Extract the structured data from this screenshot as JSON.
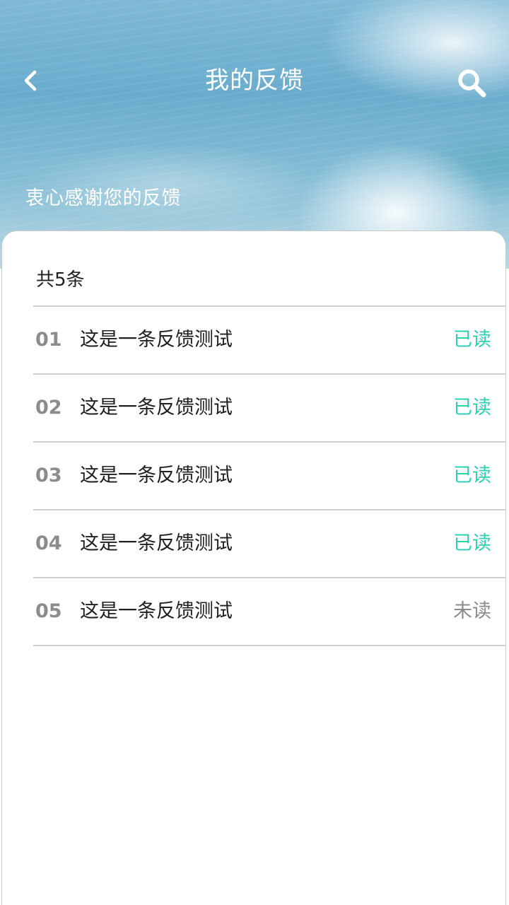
{
  "header": {
    "title": "我的反馈",
    "subtitle": "衷心感谢您的反馈",
    "back_icon": "chevron-left-icon",
    "search_icon": "search-icon"
  },
  "summary": {
    "count_label": "共5条"
  },
  "colors": {
    "read": "#2cd1b3",
    "unread": "#8c8c8c"
  },
  "feedback": [
    {
      "num": "01",
      "text": "这是一条反馈测试",
      "status": "已读",
      "read": true
    },
    {
      "num": "02",
      "text": "这是一条反馈测试",
      "status": "已读",
      "read": true
    },
    {
      "num": "03",
      "text": "这是一条反馈测试",
      "status": "已读",
      "read": true
    },
    {
      "num": "04",
      "text": "这是一条反馈测试",
      "status": "已读",
      "read": true
    },
    {
      "num": "05",
      "text": "这是一条反馈测试",
      "status": "未读",
      "read": false
    }
  ]
}
